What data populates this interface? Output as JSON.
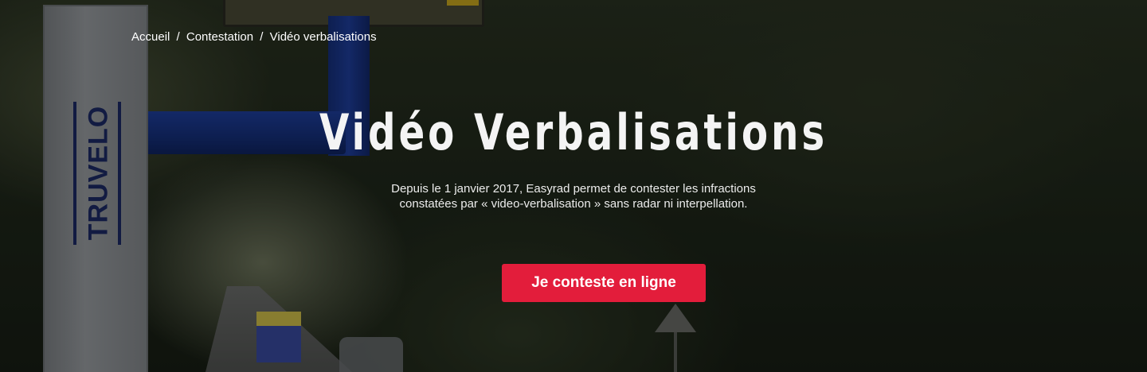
{
  "breadcrumb": {
    "items": [
      "Accueil",
      "Contestation",
      "Vidéo verbalisations"
    ],
    "separator": "/"
  },
  "hero": {
    "title": "Vidéo Verbalisations",
    "subtitle_line1": "Depuis le 1 janvier 2017, Easyrad permet de contester les infractions",
    "subtitle_line2": "constatées par « video-verbalisation » sans radar ni interpellation.",
    "cta_label": "Je conteste en ligne",
    "background_image_text": "TRUVELO"
  },
  "colors": {
    "cta_background": "#e31d3b",
    "text": "#ffffff"
  }
}
